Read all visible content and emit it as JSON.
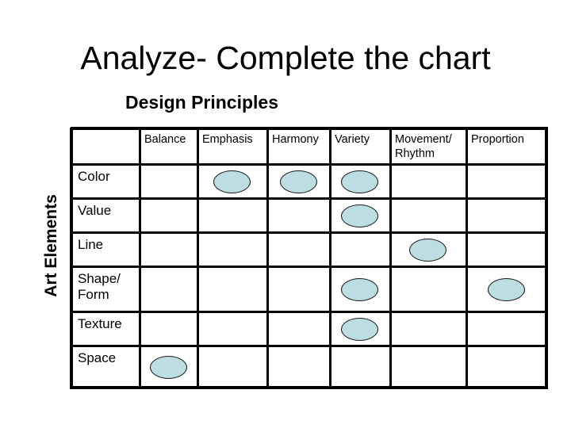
{
  "title": "Analyze- Complete the chart",
  "subtitle": "Design Principles",
  "side_label": "Art Elements",
  "columns": [
    "Balance",
    "Emphasis",
    "Harmony",
    "Variety",
    "Movement/\nRhythm",
    "Proportion"
  ],
  "rows": [
    {
      "label": "Color",
      "marked": [
        "Emphasis",
        "Harmony",
        "Variety"
      ]
    },
    {
      "label": "Value",
      "marked": [
        "Variety"
      ]
    },
    {
      "label": "Line",
      "marked": [
        "Movement/\nRhythm"
      ]
    },
    {
      "label": "Shape/\nForm",
      "marked": [
        "Variety",
        "Proportion"
      ]
    },
    {
      "label": "Texture",
      "marked": [
        "Variety"
      ]
    },
    {
      "label": "Space",
      "marked": [
        "Balance"
      ]
    }
  ],
  "marker": {
    "shape": "oval",
    "fill": "#bcdde2",
    "stroke": "#1a1a1a"
  }
}
